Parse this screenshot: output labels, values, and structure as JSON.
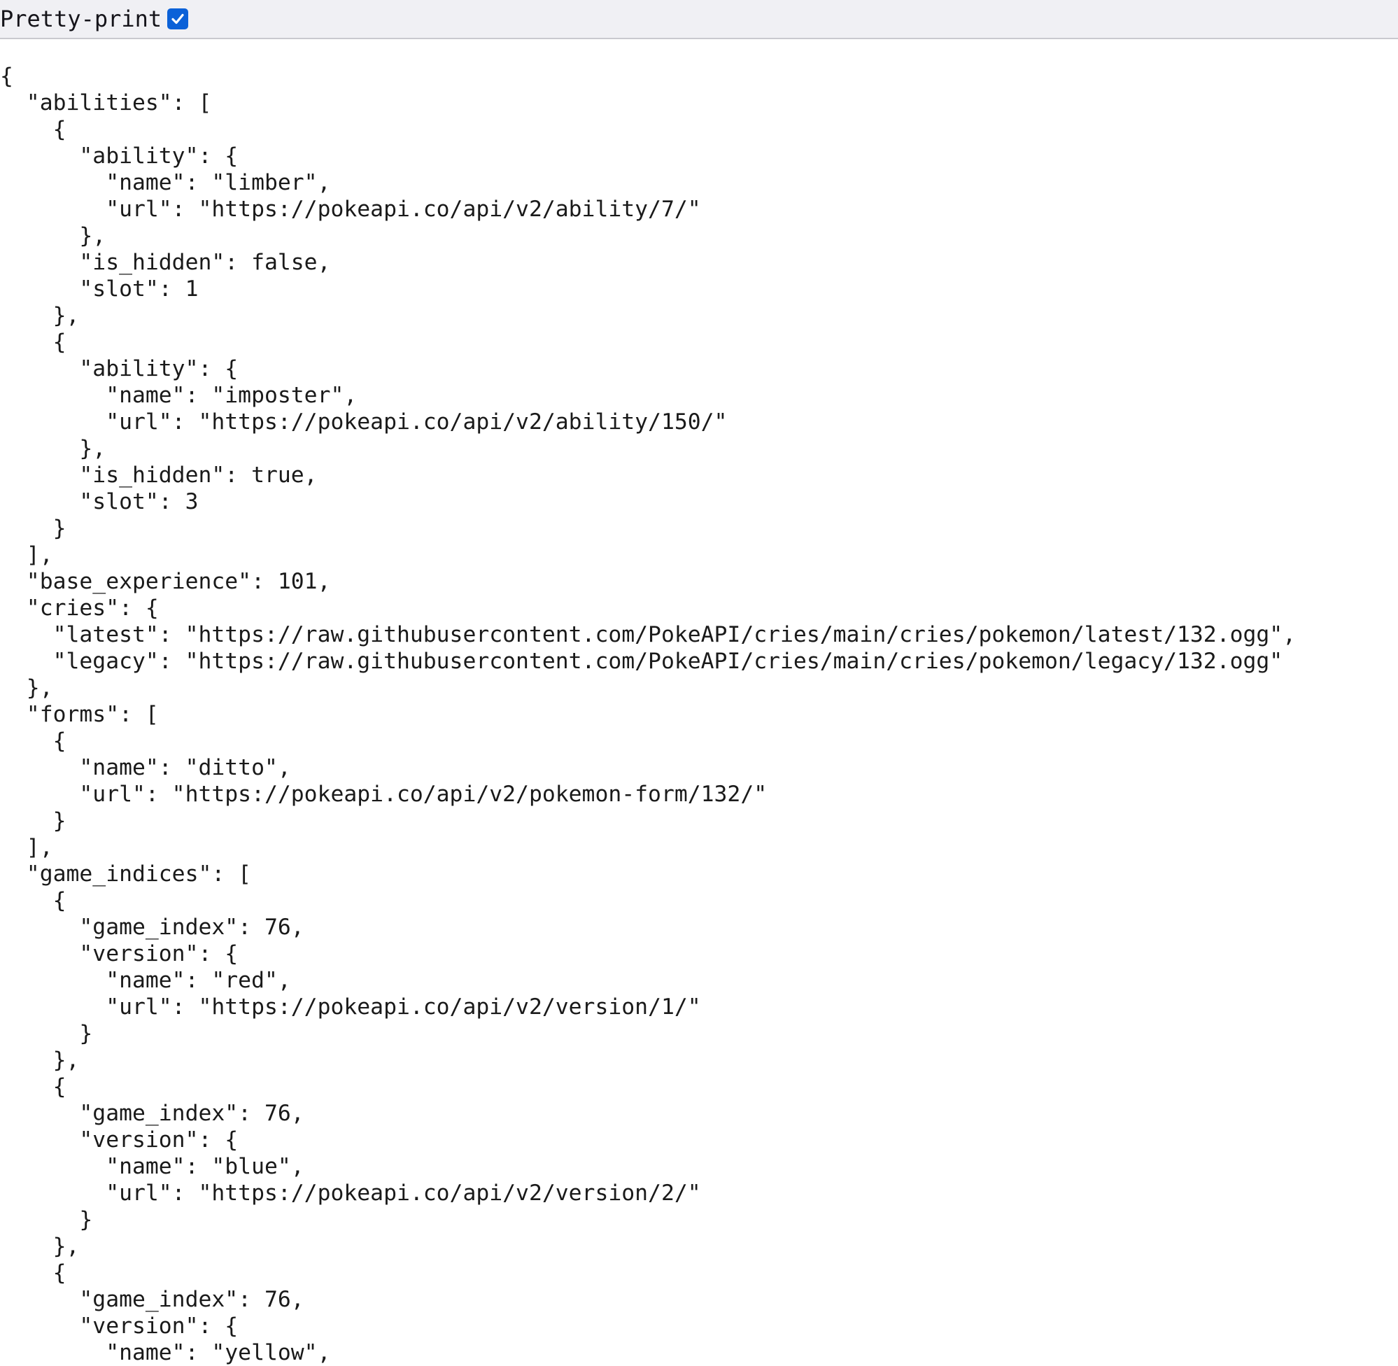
{
  "toolbar": {
    "pretty_print_label": "Pretty-print",
    "pretty_print_checked": true,
    "checkbox_color": "#0b61d8"
  },
  "json_lines": [
    "{",
    "  \"abilities\": [",
    "    {",
    "      \"ability\": {",
    "        \"name\": \"limber\",",
    "        \"url\": \"https://pokeapi.co/api/v2/ability/7/\"",
    "      },",
    "      \"is_hidden\": false,",
    "      \"slot\": 1",
    "    },",
    "    {",
    "      \"ability\": {",
    "        \"name\": \"imposter\",",
    "        \"url\": \"https://pokeapi.co/api/v2/ability/150/\"",
    "      },",
    "      \"is_hidden\": true,",
    "      \"slot\": 3",
    "    }",
    "  ],",
    "  \"base_experience\": 101,",
    "  \"cries\": {",
    "    \"latest\": \"https://raw.githubusercontent.com/PokeAPI/cries/main/cries/pokemon/latest/132.ogg\",",
    "    \"legacy\": \"https://raw.githubusercontent.com/PokeAPI/cries/main/cries/pokemon/legacy/132.ogg\"",
    "  },",
    "  \"forms\": [",
    "    {",
    "      \"name\": \"ditto\",",
    "      \"url\": \"https://pokeapi.co/api/v2/pokemon-form/132/\"",
    "    }",
    "  ],",
    "  \"game_indices\": [",
    "    {",
    "      \"game_index\": 76,",
    "      \"version\": {",
    "        \"name\": \"red\",",
    "        \"url\": \"https://pokeapi.co/api/v2/version/1/\"",
    "      }",
    "    },",
    "    {",
    "      \"game_index\": 76,",
    "      \"version\": {",
    "        \"name\": \"blue\",",
    "        \"url\": \"https://pokeapi.co/api/v2/version/2/\"",
    "      }",
    "    },",
    "    {",
    "      \"game_index\": 76,",
    "      \"version\": {",
    "        \"name\": \"yellow\","
  ]
}
